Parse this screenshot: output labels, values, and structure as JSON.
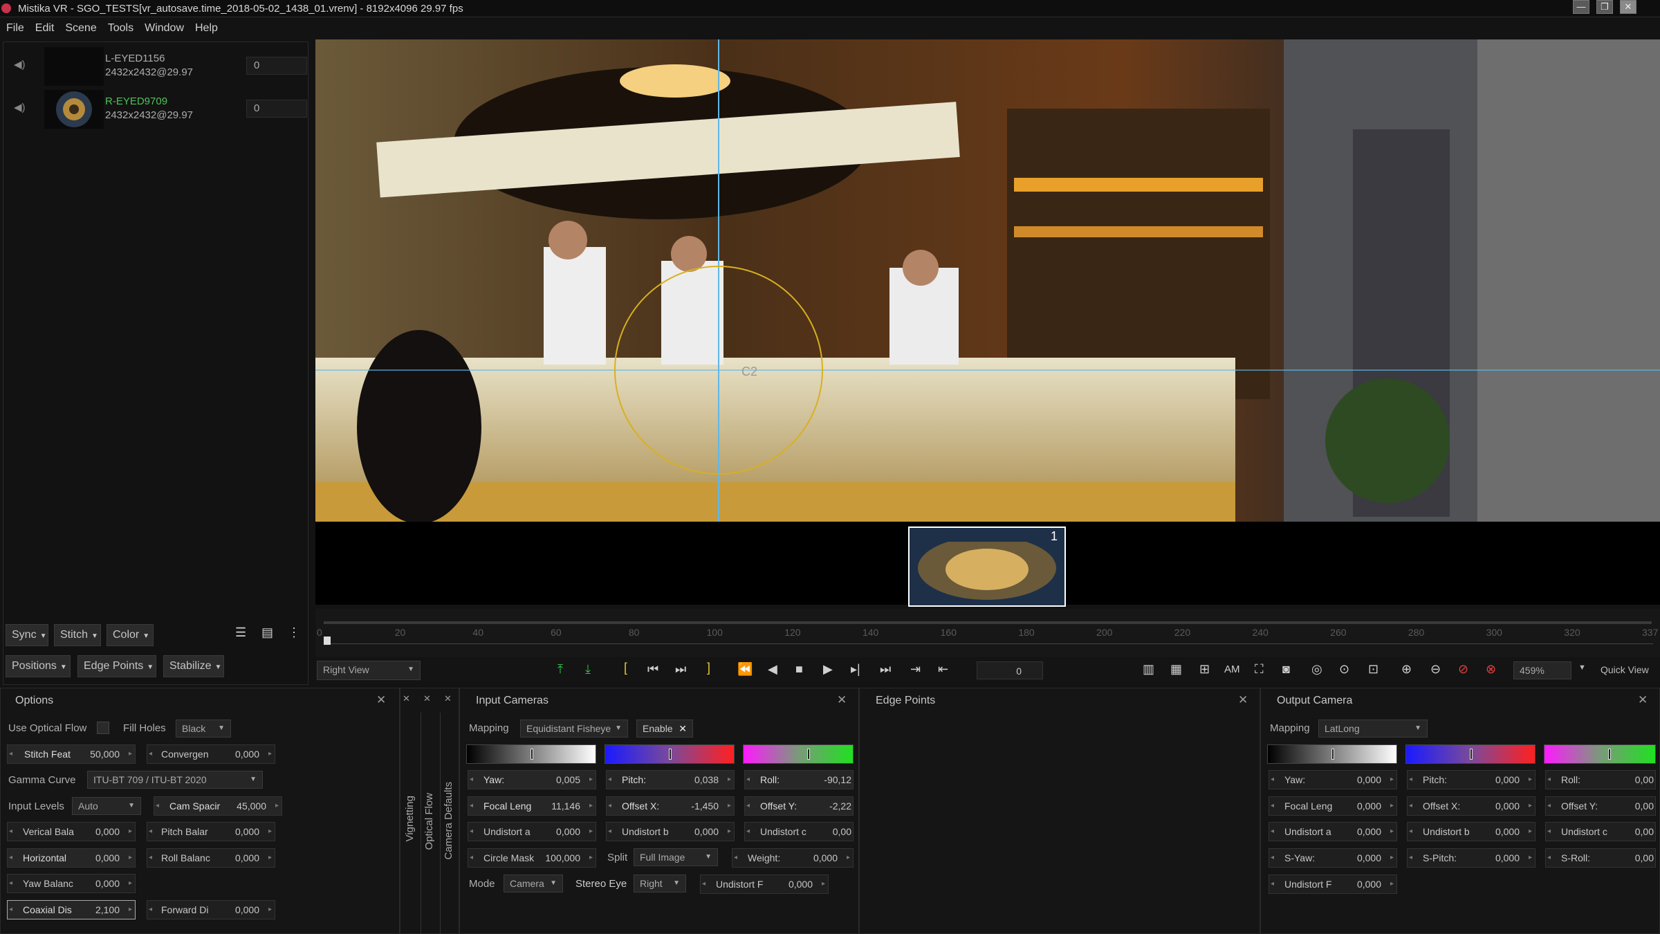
{
  "window": {
    "title": "Mistika VR - SGO_TESTS[vr_autosave.time_2018-05-02_1438_01.vrenv] - 8192x4096 29.97 fps",
    "controls": [
      "—",
      "❐",
      "✕"
    ]
  },
  "menu": [
    "File",
    "Edit",
    "Scene",
    "Tools",
    "Window",
    "Help"
  ],
  "clips": [
    {
      "name": "L-EYED1156",
      "res": "2432x2432@29.97",
      "offset": "0"
    },
    {
      "name": "R-EYED9709",
      "res": "2432x2432@29.97",
      "offset": "0"
    }
  ],
  "left_buttons": {
    "sync": "Sync",
    "stitch": "Stitch",
    "color": "Color",
    "positions": "Positions",
    "edge_points": "Edge Points",
    "stabilize": "Stabilize"
  },
  "viewer": {
    "overlay_label": "C2",
    "thumb_number": "1"
  },
  "timeline": {
    "ticks": [
      "0",
      "20",
      "40",
      "60",
      "80",
      "100",
      "120",
      "140",
      "160",
      "180",
      "200",
      "220",
      "240",
      "260",
      "280",
      "300",
      "320",
      "337"
    ]
  },
  "transport": {
    "view_select": "Right View",
    "frame": "0",
    "am": "AM",
    "zoom": "459%",
    "quick_view": "Quick View"
  },
  "options": {
    "title": "Options",
    "use_optical_flow": "Use Optical Flow",
    "fill_holes": "Fill Holes",
    "fill_holes_value": "Black",
    "stitch_feat": {
      "label": "Stitch Feat",
      "value": "50,000"
    },
    "convergence": {
      "label": "Convergen",
      "value": "0,000"
    },
    "gamma_curve": "Gamma Curve",
    "gamma_value": "ITU-BT 709 / ITU-BT 2020",
    "input_levels": "Input Levels",
    "input_levels_value": "Auto",
    "cam_spacing": {
      "label": "Cam Spacir",
      "value": "45,000"
    },
    "vertical_bal": {
      "label": "Verical Bala",
      "value": "0,000"
    },
    "pitch_bal": {
      "label": "Pitch Balar",
      "value": "0,000"
    },
    "horizontal": {
      "label": "Horizontal",
      "value": "0,000"
    },
    "roll_bal": {
      "label": "Roll Balanc",
      "value": "0,000"
    },
    "yaw_bal": {
      "label": "Yaw Balanc",
      "value": "0,000"
    },
    "coaxial": {
      "label": "Coaxial Dis",
      "value": "2,100"
    },
    "forward": {
      "label": "Forward Di",
      "value": "0,000"
    }
  },
  "vtabs": [
    "Vignetting",
    "Optical Flow",
    "Camera Defaults"
  ],
  "input_cameras": {
    "title": "Input Cameras",
    "mapping": "Mapping",
    "mapping_value": "Equidistant Fisheye",
    "enable": "Enable",
    "yaw": {
      "label": "Yaw:",
      "value": "0,005"
    },
    "pitch": {
      "label": "Pitch:",
      "value": "0,038"
    },
    "roll": {
      "label": "Roll:",
      "value": "-90,12"
    },
    "focal": {
      "label": "Focal Leng",
      "value": "11,146"
    },
    "offset_x": {
      "label": "Offset X:",
      "value": "-1,450"
    },
    "offset_y": {
      "label": "Offset Y:",
      "value": "-2,22"
    },
    "undistort_a": {
      "label": "Undistort a",
      "value": "0,000"
    },
    "undistort_b": {
      "label": "Undistort b",
      "value": "0,000"
    },
    "undistort_c": {
      "label": "Undistort c",
      "value": "0,00"
    },
    "circle_mask": {
      "label": "Circle Mask",
      "value": "100,000"
    },
    "split": "Split",
    "split_value": "Full Image",
    "weight": {
      "label": "Weight:",
      "value": "0,000"
    },
    "mode": "Mode",
    "mode_value": "Camera",
    "stereo_eye": "Stereo Eye",
    "stereo_value": "Right",
    "undistort_f": {
      "label": "Undistort F",
      "value": "0,000"
    }
  },
  "edge_points": {
    "title": "Edge Points"
  },
  "output_camera": {
    "title": "Output Camera",
    "mapping": "Mapping",
    "mapping_value": "LatLong",
    "yaw": {
      "label": "Yaw:",
      "value": "0,000"
    },
    "pitch": {
      "label": "Pitch:",
      "value": "0,000"
    },
    "roll": {
      "label": "Roll:",
      "value": "0,00"
    },
    "focal": {
      "label": "Focal Leng",
      "value": "0,000"
    },
    "offset_x": {
      "label": "Offset X:",
      "value": "0,000"
    },
    "offset_y": {
      "label": "Offset Y:",
      "value": "0,00"
    },
    "undistort_a": {
      "label": "Undistort a",
      "value": "0,000"
    },
    "undistort_b": {
      "label": "Undistort b",
      "value": "0,000"
    },
    "undistort_c": {
      "label": "Undistort c",
      "value": "0,00"
    },
    "s_yaw": {
      "label": "S-Yaw:",
      "value": "0,000"
    },
    "s_pitch": {
      "label": "S-Pitch:",
      "value": "0,000"
    },
    "s_roll": {
      "label": "S-Roll:",
      "value": "0,00"
    },
    "undistort_f": {
      "label": "Undistort F",
      "value": "0,000"
    }
  }
}
